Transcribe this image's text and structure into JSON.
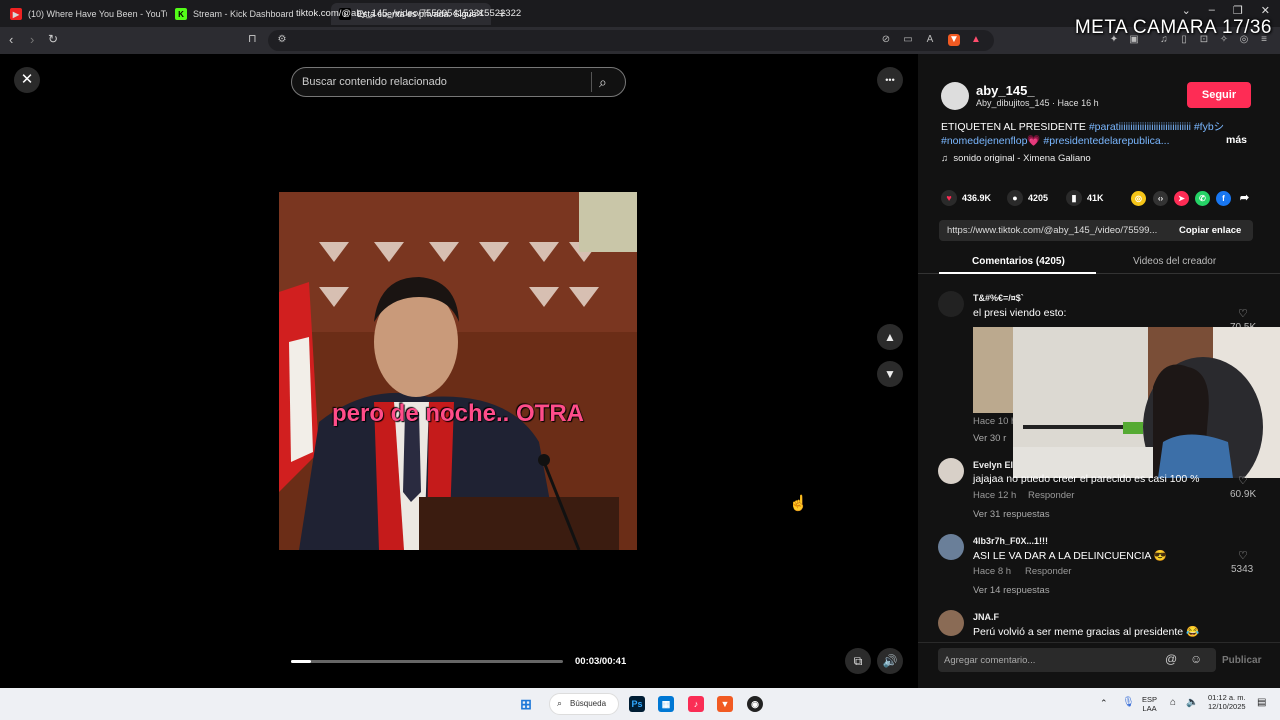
{
  "browser": {
    "tabs": [
      {
        "title": "(10) Where Have You Been - YouTube",
        "favicon": "youtube-icon",
        "active": false
      },
      {
        "title": "Stream - Kick Dashboard",
        "favicon": "kick-icon",
        "active": false
      },
      {
        "title": "Esta cuenta es privada. Sigue",
        "favicon": "tiktok-icon",
        "active": true
      }
    ],
    "new_tab": "+",
    "url": "tiktok.com/@aby_145_/video/7559954152315522322"
  },
  "overlay_title": "META CAMARA 17/36",
  "player": {
    "close": "✕",
    "search_placeholder": "Buscar contenido relacionado",
    "more": "•••",
    "caption": "pero de noche.. OTRA",
    "time": "00:03/00:41",
    "progress": 0.073,
    "up": "⌃",
    "down": "⌄"
  },
  "post": {
    "username": "aby_145_",
    "display_name_time": "Aby_dibujitos_145 · Hace 16 h",
    "follow": "Seguir",
    "description_plain": "ETIQUETEN AL PRESIDENTE ",
    "tag1": "#paratiiiiiiiiiiiiiiiiiiiiiiiiiiiiiii",
    "tag2": "#fybシ",
    "tag3": "#nomedejenenflop",
    "heart_emoji": "💗",
    "tag4": "#presidentedelarepublica...",
    "more": "más",
    "sound": "sonido original - Ximena Galiano",
    "likes": "436.9K",
    "comments": "4205",
    "saves": "41K",
    "link": "https://www.tiktok.com/@aby_145_/video/75599...",
    "copy_link": "Copiar enlace"
  },
  "panel_tabs": {
    "comments": "Comentarios (4205)",
    "creator_videos": "Videos del creador"
  },
  "comments": [
    {
      "name": "T&#%€=/¤$`",
      "text": "el presi viendo esto:",
      "meta": "Hace 10 h",
      "replies": "Ver 30 r",
      "likes": "70.5K"
    },
    {
      "name": "Evelyn El",
      "text": "jajajaa no puedo creer el parecido es casi 100 %",
      "meta": "Hace 12 h",
      "reply": "Responder",
      "replies": "Ver 31 respuestas",
      "likes": "60.9K"
    },
    {
      "name": "4lb3r7h_F0X...1!!!",
      "text": "ASI LE VA DAR A LA DELINCUENCIA 😎",
      "meta": "Hace 8 h",
      "reply": "Responder",
      "replies": "Ver 14 respuestas",
      "likes": "5343"
    },
    {
      "name": "JNA.F",
      "text": "Perú volvió a ser meme gracias al presidente 😂",
      "meta": "",
      "replies": "",
      "likes": ""
    }
  ],
  "add_comment": {
    "placeholder": "Agregar comentario...",
    "publish": "Publicar"
  },
  "taskbar": {
    "search": "Búsqueda",
    "lang1": "ESP",
    "lang2": "LAA",
    "time": "01:12 a. m.",
    "date": "12/10/2025"
  }
}
